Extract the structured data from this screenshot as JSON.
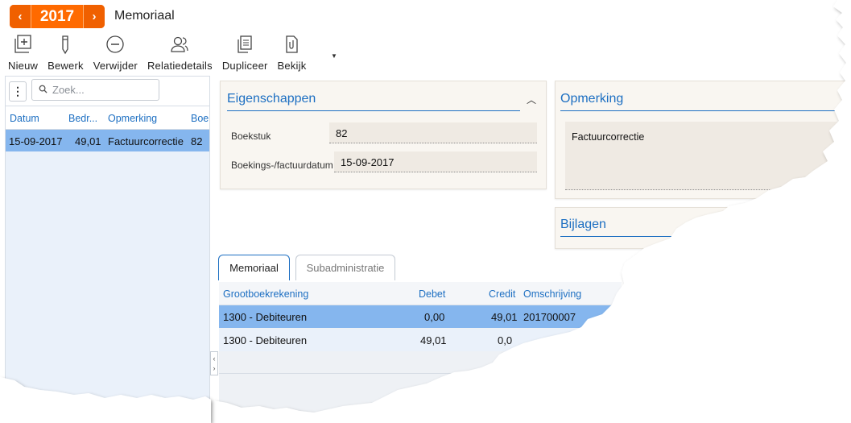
{
  "header": {
    "year": "2017",
    "prev_icon": "chevron-left-icon",
    "next_icon": "chevron-right-icon",
    "title": "Memoriaal"
  },
  "toolbar": {
    "nieuw": "Nieuw",
    "bewerk": "Bewerk",
    "verwijder": "Verwijder",
    "relatiedetails": "Relatiedetails",
    "dupliceer": "Dupliceer",
    "bekijk": "Bekijk"
  },
  "list": {
    "search_placeholder": "Zoek...",
    "columns": [
      "Datum",
      "Bedr...",
      "Opmerking",
      "Boe"
    ],
    "rows": [
      {
        "datum": "15-09-2017",
        "bedrag": "49,01",
        "opmerking": "Factuurcorrectie",
        "boekstuk": "82"
      }
    ]
  },
  "eigenschappen": {
    "title": "Eigenschappen",
    "boekstuk_label": "Boekstuk",
    "boekstuk_value": "82",
    "datum_label": "Boekings-/factuurdatum",
    "datum_value": "15-09-2017"
  },
  "opmerking": {
    "title": "Opmerking",
    "value": "Factuurcorrectie"
  },
  "bijlagen": {
    "title": "Bijlagen"
  },
  "tabs": [
    "Memoriaal",
    "Subadministratie"
  ],
  "grid": {
    "columns": [
      "Grootboekrekening",
      "Debet",
      "Credit",
      "Omschrijving"
    ],
    "rows": [
      {
        "rekening": "1300 - Debiteuren",
        "debet": "0,00",
        "credit": "49,01",
        "omschrijving": "201700007"
      },
      {
        "rekening": "1300 - Debiteuren",
        "debet": "49,01",
        "credit": "0,0",
        "omschrijving": ""
      }
    ]
  },
  "colors": {
    "accent": "#ff6a00",
    "link_blue": "#1d6fc2",
    "selected_row": "#85b6ee"
  }
}
